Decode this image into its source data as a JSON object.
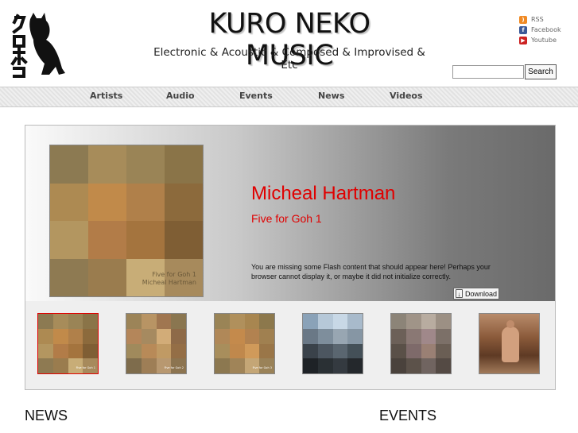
{
  "header": {
    "logo_alt": "クロネコ",
    "title": "KURO NEKO MUSIC",
    "tagline": "Electronic & Acoustic & Composed & Improvised & Etc"
  },
  "social": [
    {
      "label": "RSS",
      "icon": "rss-icon"
    },
    {
      "label": "Facebook",
      "icon": "facebook-icon"
    },
    {
      "label": "Youtube",
      "icon": "youtube-icon"
    }
  ],
  "search": {
    "value": "",
    "placeholder": "",
    "button_label": "Search"
  },
  "nav": [
    "Artists",
    "Audio",
    "Events",
    "News",
    "Videos"
  ],
  "feature": {
    "artist": "Micheal Hartman",
    "album": "Five for Goh 1",
    "cover_caption_line1": "Five for Goh 1",
    "cover_caption_line2": "Micheal Hartman",
    "flash_message": "You are missing some Flash content that should appear here! Perhaps your browser cannot display it, or maybe it did not initialize correctly.",
    "download_label": "Download"
  },
  "thumbnails": [
    {
      "caption": "Five for Goh 1",
      "selected": true
    },
    {
      "caption": "Five for Goh 2",
      "selected": false
    },
    {
      "caption": "Five for Goh 3",
      "selected": false
    },
    {
      "caption": "",
      "selected": false
    },
    {
      "caption": "",
      "selected": false
    },
    {
      "caption": "",
      "selected": false
    }
  ],
  "sections": {
    "news": "NEWS",
    "events": "EVENTS"
  },
  "colors": {
    "accent": "#e00000"
  }
}
